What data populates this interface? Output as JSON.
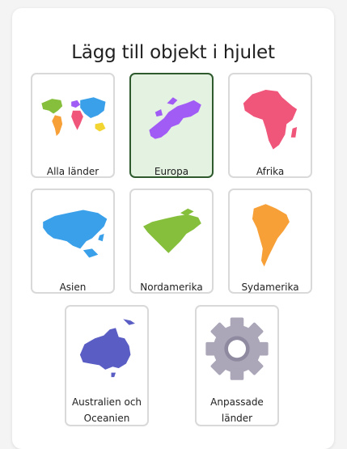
{
  "dialog": {
    "title": "Lägg till objekt i hjulet"
  },
  "options": [
    {
      "label": "Alla länder",
      "icon": "world-map-icon",
      "selected": false
    },
    {
      "label": "Europa",
      "icon": "europe-map-icon",
      "selected": true
    },
    {
      "label": "Afrika",
      "icon": "africa-map-icon",
      "selected": false
    },
    {
      "label": "Asien",
      "icon": "asia-map-icon",
      "selected": false
    },
    {
      "label": "Nordamerika",
      "icon": "north-america-map-icon",
      "selected": false
    },
    {
      "label": "Sydamerika",
      "icon": "south-america-map-icon",
      "selected": false
    },
    {
      "label": "Australien och Oceanien",
      "icon": "australia-map-icon",
      "selected": false
    },
    {
      "label": "Anpassade länder",
      "icon": "gear-icon",
      "selected": false
    }
  ],
  "colors": {
    "selected_bg": "#e3f2e1",
    "selected_border": "#2e5a2e",
    "europe": "#a05cf5",
    "africa": "#f0557a",
    "asia": "#3aa0ea",
    "north_america": "#86bf3c",
    "south_america": "#f8a038",
    "oceania": "#5a5ec4",
    "gear": "#aba6b8"
  }
}
